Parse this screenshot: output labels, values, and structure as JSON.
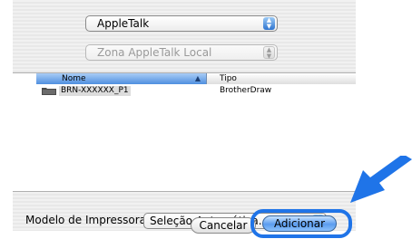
{
  "dialog": {
    "protocol_popup": {
      "selected": "AppleTalk",
      "icon": "popup-arrows-icon"
    },
    "zone_popup": {
      "selected": "Zona AppleTalk Local",
      "disabled": true,
      "icon": "popup-arrows-icon"
    },
    "printer_list": {
      "columns": [
        {
          "label": "Nome",
          "sorted": true,
          "sort_icon": "sort-ascending-icon"
        },
        {
          "label": "Tipo"
        }
      ],
      "rows": [
        {
          "icon": "printer-folder-icon",
          "name": "BRN-XXXXXX_P1",
          "type": "BrotherDraw",
          "selected": true
        }
      ]
    },
    "model": {
      "label": "Modelo de Impressora:",
      "selected": "Seleção Automática...",
      "icon": "popup-arrows-icon"
    },
    "buttons": {
      "cancel_label": "Cancelar",
      "add_label": "Adicionar"
    }
  },
  "annotation": {
    "arrow_color": "#1f74e8",
    "highlight_target": "add-button"
  }
}
